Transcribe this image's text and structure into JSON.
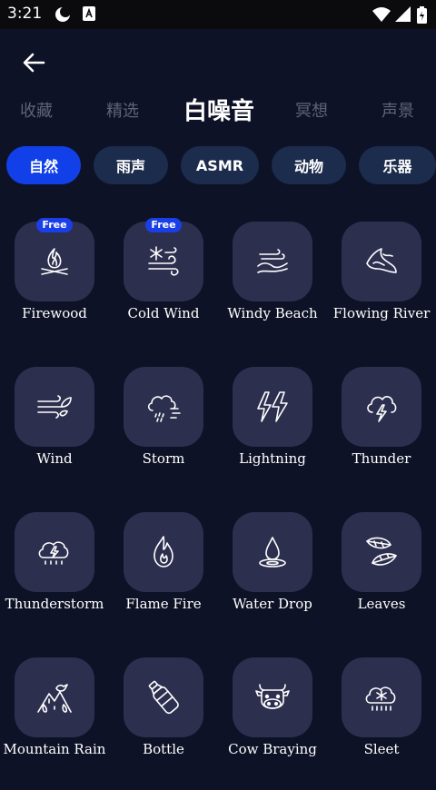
{
  "status": {
    "time": "3:21"
  },
  "tabs": [
    {
      "label": "收藏",
      "active": false
    },
    {
      "label": "精选",
      "active": false
    },
    {
      "label": "白噪音",
      "active": true
    },
    {
      "label": "冥想",
      "active": false
    },
    {
      "label": "声景",
      "active": false
    }
  ],
  "chips": [
    {
      "label": "自然",
      "active": true
    },
    {
      "label": "雨声",
      "active": false
    },
    {
      "label": "ASMR",
      "active": false
    },
    {
      "label": "动物",
      "active": false
    },
    {
      "label": "乐器",
      "active": false
    }
  ],
  "sounds": [
    {
      "label": "Firewood",
      "badge": "Free",
      "icon": "campfire-icon"
    },
    {
      "label": "Cold Wind",
      "badge": "Free",
      "icon": "snow-wind-icon"
    },
    {
      "label": "Windy Beach",
      "badge": "",
      "icon": "wind-waves-icon"
    },
    {
      "label": "Flowing River",
      "badge": "",
      "icon": "river-icon"
    },
    {
      "label": "Wind",
      "badge": "",
      "icon": "wind-leaf-icon"
    },
    {
      "label": "Storm",
      "badge": "",
      "icon": "storm-cloud-icon"
    },
    {
      "label": "Lightning",
      "badge": "",
      "icon": "lightning-icon"
    },
    {
      "label": "Thunder",
      "badge": "",
      "icon": "thunder-cloud-icon"
    },
    {
      "label": "Thunderstorm",
      "badge": "",
      "icon": "thunderstorm-icon"
    },
    {
      "label": "Flame Fire",
      "badge": "",
      "icon": "flame-icon"
    },
    {
      "label": "Water Drop",
      "badge": "",
      "icon": "water-drop-icon"
    },
    {
      "label": "Leaves",
      "badge": "",
      "icon": "leaves-icon"
    },
    {
      "label": "Mountain Rain",
      "badge": "",
      "icon": "mountain-rain-icon"
    },
    {
      "label": "Bottle",
      "badge": "",
      "icon": "bottle-icon"
    },
    {
      "label": "Cow Braying",
      "badge": "",
      "icon": "cow-icon"
    },
    {
      "label": "Sleet",
      "badge": "",
      "icon": "sleet-icon"
    }
  ]
}
